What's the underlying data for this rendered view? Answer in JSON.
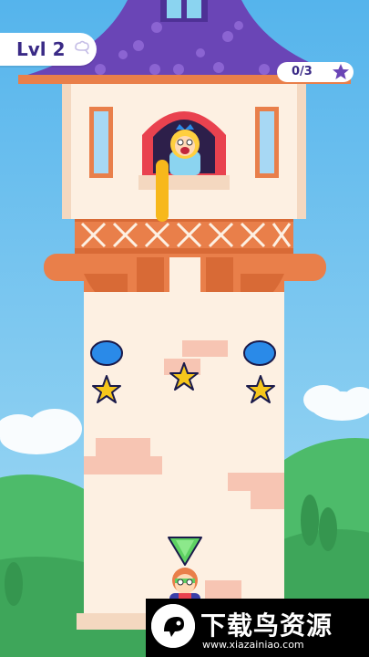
{
  "hud": {
    "level_label": "Lvl 2",
    "stars_counter": "0/3"
  },
  "watermark": {
    "title": "下载鸟资源",
    "url": "www.xiazainiao.com"
  },
  "colors": {
    "sky": "#6ec4ec",
    "roof": "#6a45b6",
    "tower_wall": "#fdf0e2",
    "balcony": "#e97f4a",
    "bubble": "#2a8ae8",
    "star": "#f6c61b",
    "accent_purple": "#3a2a86"
  },
  "icons": {
    "level_icon": "cloud-key-icon",
    "stars_icon": "purple-star-icon",
    "watermark_logo": "bird-logo-icon"
  }
}
